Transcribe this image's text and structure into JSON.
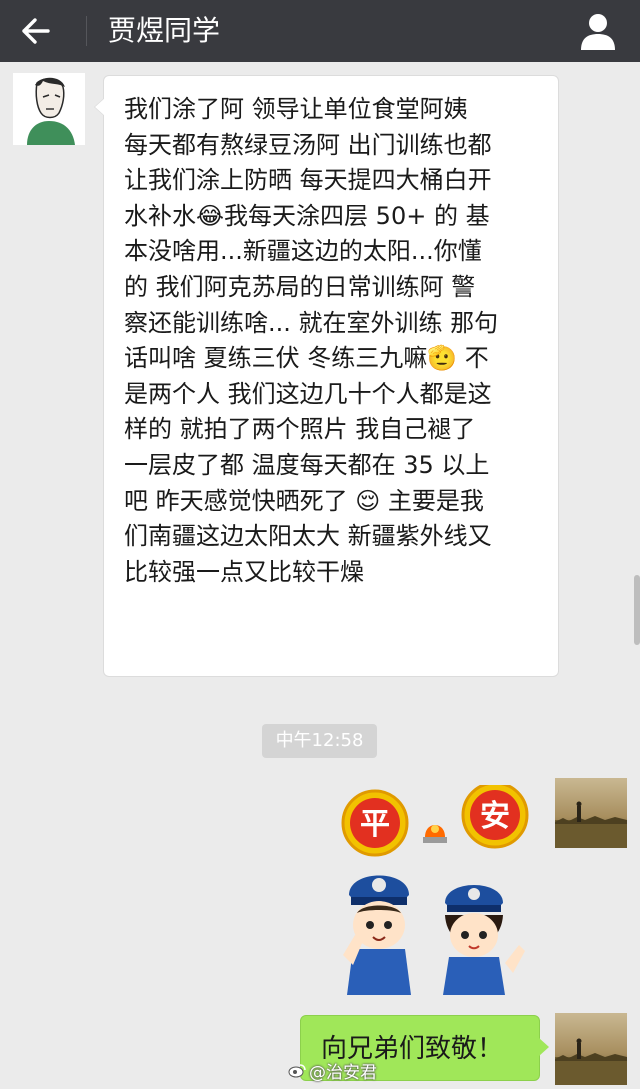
{
  "header": {
    "title": "贾煜同学",
    "back_icon": "back-arrow-icon",
    "profile_icon": "person-icon",
    "background": "#393a3f"
  },
  "messages": [
    {
      "side": "left",
      "lines": [
        "我们涂了阿 领导让单位食堂阿姨",
        "每天都有熬绿豆汤阿 出门训练也都",
        "让我们涂上防晒 每天提四大桶白开",
        "水补水😂我每天涂四层 50+ 的 基",
        "本没啥用...新疆这边的太阳...你懂",
        "的   我们阿克苏局的日常训练阿 警",
        "察还能训练啥... 就在室外训练 那句",
        "话叫啥 夏练三伏 冬练三九嘛🫡  不",
        "是两个人 我们这边几十个人都是这",
        "样的 就拍了两个照片 我自己褪了",
        "一层皮了都 温度每天都在 35 以上",
        "吧 昨天感觉快晒死了 😌 主要是我",
        "们南疆这边太阳太大 新疆紫外线又",
        "比较强一点又比较干燥"
      ]
    },
    {
      "side": "right",
      "type": "sticker",
      "sticker_text": [
        "平",
        "安"
      ]
    },
    {
      "side": "right",
      "text": "向兄弟们致敬！"
    }
  ],
  "timestamp": "中午12:58",
  "watermark": "@治安君",
  "colors": {
    "chat_bg": "#ebebeb",
    "left_bubble": "#ffffff",
    "right_bubble": "#a0e759",
    "timestamp_bg": "#d4d4d4"
  }
}
